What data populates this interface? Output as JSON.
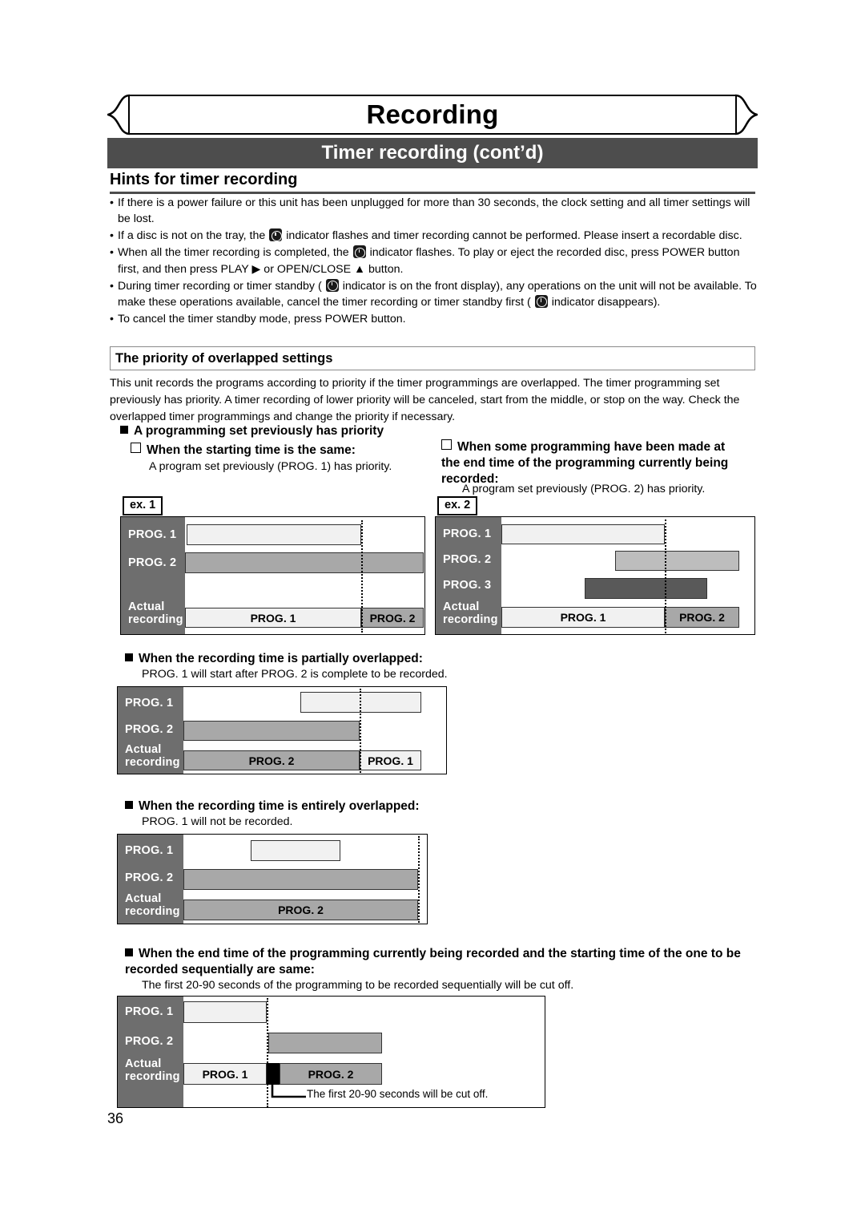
{
  "header": {
    "banner_title": "Recording",
    "sub_title": "Timer recording (cont’d)",
    "section_title": "Hints for timer recording"
  },
  "bullets": [
    {
      "id": "power-failure",
      "parts": [
        "If there is a power failure or this unit has been unplugged for more than 30 seconds, the clock setting and all timer settings will be lost."
      ]
    },
    {
      "id": "no-disc",
      "pre": "If a disc is not on the tray, the",
      "icon": "timer-indicator-icon",
      "post": "indicator flashes and timer recording cannot be performed. Please insert a recordable disc."
    },
    {
      "id": "recording-completed",
      "pre": "When all the timer recording is completed, the",
      "icon": "timer-indicator-icon",
      "post": "indicator flashes. To play or eject the recorded disc, press POWER button first, and then press PLAY ▶ or OPEN/CLOSE ▲ button."
    },
    {
      "id": "during-timer-standby",
      "pre": "During timer recording or timer standby (",
      "icon": "timer-indicator-icon",
      "mid": "indicator is on the front display), any operations on the unit will not be available. To make these operations available, cancel the timer recording or timer standby first (",
      "icon2": "timer-indicator-icon",
      "post": "indicator disappears)."
    },
    {
      "id": "cancel-standby",
      "parts": [
        "To cancel the timer standby mode, press POWER button."
      ]
    }
  ],
  "priority": {
    "box_title": "The priority of overlapped settings",
    "paragraph": "This unit records the programs according to priority if the timer programmings are overlapped. The timer programming set previously has priority.  A timer recording of lower priority will be canceled, start from the middle, or stop on the way.  Check the overlapped timer programmings and change the priority if necessary.",
    "head1": "A programming set previously has priority",
    "sub1_title": "When the starting time is the same:",
    "sub1_note": "A program set previously (PROG. 1) has priority.",
    "sub2_title": "When some programming have been made at the end time of the programming currently being recorded:",
    "sub2_note": "A program set previously (PROG. 2) has priority.",
    "head2": "When the recording time is partially overlapped:",
    "head2_note": "PROG. 1 will start after PROG. 2 is complete to be recorded.",
    "head3": "When the recording time is entirely overlapped:",
    "head3_note": "PROG. 1 will not be recorded.",
    "head4": "When the end time of the programming currently being recorded and the starting time of the one to be recorded sequentially are same:",
    "head4_note": "The first 20-90 seconds of the programming to be recorded sequentially will be cut off."
  },
  "labels": {
    "ex1": "ex. 1",
    "ex2": "ex. 2",
    "prog1": "PROG. 1",
    "prog2": "PROG. 2",
    "prog3": "PROG. 3",
    "actual_line1": "Actual",
    "actual_line2": "recording",
    "cut_off_caption": "The first 20-90 seconds will be cut off."
  },
  "page": {
    "number": "36"
  },
  "colors": {
    "header_bar": "#4d4d4d",
    "label_col": "#6e6e6e",
    "prog1_fill": "#f1f1f1",
    "prog2_fill": "#a8a8a8",
    "prog2_light_fill": "#bdbdbd",
    "prog3_fill": "#595959",
    "cut_fill": "#000000"
  }
}
